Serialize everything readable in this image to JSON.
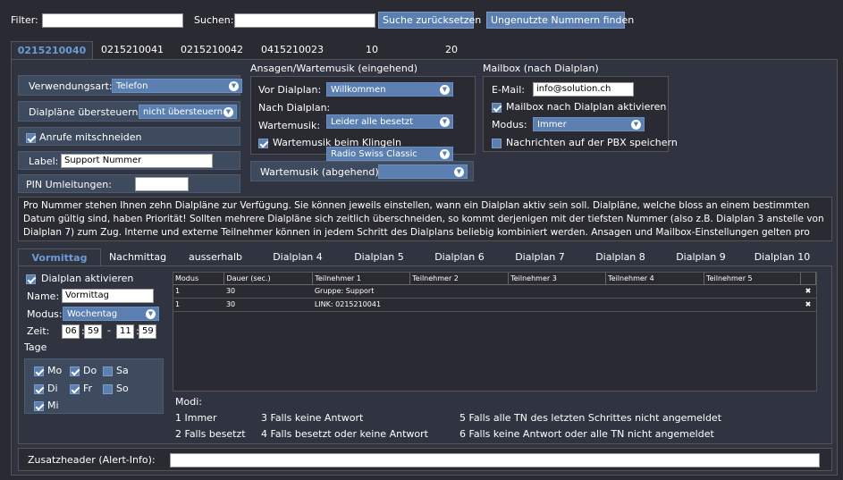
{
  "toolbar": {
    "filter_label": "Filter:",
    "filter_value": "",
    "search_label": "Suchen:",
    "search_value": "",
    "reset_button": "Suche zurücksetzen",
    "unused_button": "Ungenutzte Nummern finden"
  },
  "number_tabs": [
    "0215210040",
    "0215210041",
    "0215210042",
    "0415210023",
    "10",
    "20"
  ],
  "left_panel": {
    "usage_label": "Verwendungsart:",
    "usage_value": "Telefon",
    "override_label": "Dialpläne übersteuern:",
    "override_value": "nicht übersteuern",
    "record_label": "Anrufe mitschneiden",
    "record_checked": true,
    "label_label": "Label:",
    "label_value": "Support Nummer",
    "pin_label": "PIN Umleitungen:",
    "pin_value": ""
  },
  "announcements": {
    "title": "Ansagen/Wartemusik (eingehend)",
    "before_label": "Vor Dialplan:",
    "before_value": "Willkommen",
    "after_label": "Nach Dialplan:",
    "after_value": "Leider alle besetzt",
    "music_label": "Wartemusik:",
    "music_value": "Radio Swiss Classic",
    "ring_music_label": "Wartemusik beim Klingeln",
    "ring_music_checked": true,
    "outgoing_label": "Wartemusik (abgehend):",
    "outgoing_value": ""
  },
  "mailbox": {
    "title": "Mailbox (nach Dialplan)",
    "email_label": "E-Mail:",
    "email_value": "info@solution.ch",
    "activate_label": "Mailbox nach Dialplan aktivieren",
    "activate_checked": true,
    "mode_label": "Modus:",
    "mode_value": "Immer",
    "store_label": "Nachrichten auf der PBX speichern",
    "store_checked": false
  },
  "info_text": "Pro Nummer stehen Ihnen zehn Dialpläne zur Verfügung. Sie können jeweils einstellen, wann ein Dialplan aktiv sein soll. Dialpläne, welche bloss an einem bestimmten Datum gültig sind, haben Priorität! Sollten mehrere Dialpläne sich zeitlich überschneiden, so kommt derjenigen mit der tiefsten Nummer (also z.B. Dialplan 3 anstelle von Dialplan 7) zum Zug. Interne und externe Teilnehmer können in jedem Schritt des Dialplans beliebig kombiniert werden. Ansagen und Mailbox-Einstellungen gelten pro Dialplan!",
  "dialplan_tabs": [
    "Vormittag",
    "Nachmittag",
    "ausserhalb",
    "Dialplan 4",
    "Dialplan 5",
    "Dialplan 6",
    "Dialplan 7",
    "Dialplan 8",
    "Dialplan 9",
    "Dialplan 10"
  ],
  "dialplan": {
    "activate_label": "Dialplan aktivieren",
    "activate_checked": true,
    "name_label": "Name:",
    "name_value": "Vormittag",
    "mode_label": "Modus:",
    "mode_value": "Wochentag",
    "time_label": "Zeit:",
    "time_from_h": "06",
    "time_from_m": "59",
    "time_sep": "-",
    "time_to_h": "11",
    "time_to_m": "59",
    "days_label": "Tage",
    "days": [
      {
        "label": "Mo",
        "checked": true
      },
      {
        "label": "Do",
        "checked": true
      },
      {
        "label": "Sa",
        "checked": false
      },
      {
        "label": "Di",
        "checked": true
      },
      {
        "label": "Fr",
        "checked": true
      },
      {
        "label": "So",
        "checked": false
      },
      {
        "label": "Mi",
        "checked": true
      }
    ]
  },
  "steps_table": {
    "columns": [
      "Modus",
      "Dauer (sec.)",
      "Teilnehmer 1",
      "Teilnehmer 2",
      "Teilnehmer 3",
      "Teilnehmer 4",
      "Teilnehmer 5"
    ],
    "rows": [
      [
        "1",
        "30",
        "Gruppe: Support",
        "",
        "",
        "",
        ""
      ],
      [
        "1",
        "30",
        "LINK: 0215210041",
        "",
        "",
        "",
        ""
      ]
    ]
  },
  "modes": {
    "title": "Modi:",
    "items": [
      "1  Immer",
      "2  Falls besetzt",
      "3  Falls keine Antwort",
      "4  Falls besetzt oder keine Antwort",
      "5  Falls alle TN des letzten Schrittes nicht angemeldet",
      "6  Falls keine Antwort oder alle TN nicht angemeldet"
    ]
  },
  "footer": {
    "header_label": "Zusatzheader (Alert-Info):",
    "header_value": ""
  }
}
